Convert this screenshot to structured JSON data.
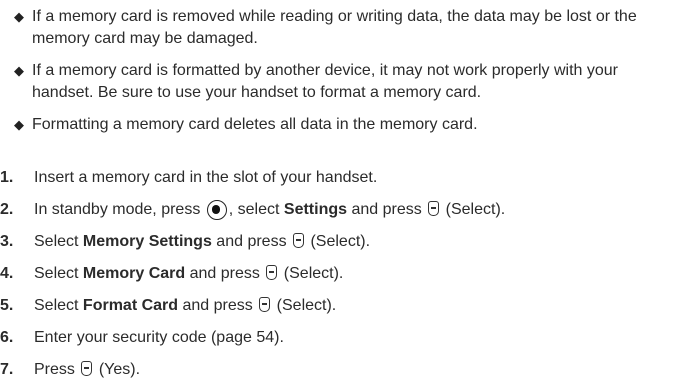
{
  "bullets": [
    "If a memory card is removed while reading or writing data, the data may be lost or the memory card may be damaged.",
    "If a memory card is formatted by another device, it may not work properly with your handset. Be sure to use your handset to format a memory card.",
    "Formatting a memory card deletes all data in the memory card."
  ],
  "steps": [
    {
      "num": "1.",
      "pre": "Insert a memory card in the slot of your handset."
    },
    {
      "num": "2.",
      "pre": "In standby mode, press",
      "post1": ", select",
      "bold": "Settings",
      "post2": "and press",
      "post3": "(Select)."
    },
    {
      "num": "3.",
      "pre": "Select",
      "bold": "Memory Settings",
      "post2": "and press",
      "post3": "(Select)."
    },
    {
      "num": "4.",
      "pre": "Select",
      "bold": "Memory Card",
      "post2": "and press",
      "post3": "(Select)."
    },
    {
      "num": "5.",
      "pre": "Select",
      "bold": "Format Card",
      "post2": "and press",
      "post3": "(Select)."
    },
    {
      "num": "6.",
      "pre": "Enter your security code (page 54)."
    },
    {
      "num": "7.",
      "pre": "Press",
      "post3": "(Yes)."
    }
  ],
  "icons": {
    "bullet_marker": "diamond-bullet",
    "nav_key": "navigation-key-icon",
    "softkey": "left-softkey-icon"
  }
}
